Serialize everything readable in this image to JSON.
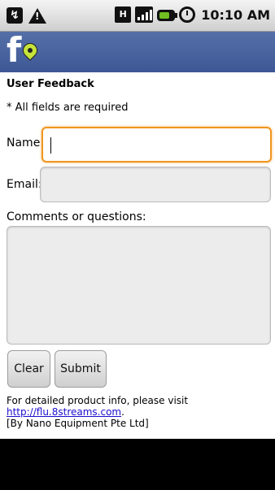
{
  "status_bar": {
    "time": "10:10 AM"
  },
  "app": {
    "logo_text": "f"
  },
  "form": {
    "title": "User Feedback",
    "required_note": "* All fields are required",
    "name_label": "Name:",
    "name_value": "",
    "email_label": "Email:",
    "email_value": "",
    "comments_label": "Comments or questions:",
    "comments_value": "",
    "clear_label": "Clear",
    "submit_label": "Submit"
  },
  "footer": {
    "info_text": "For detailed product info, please visit",
    "link_text": "http://flu.8streams.com",
    "link_suffix": ".",
    "company": "[By Nano Equipment Pte Ltd]"
  },
  "colors": {
    "header_bg": "#4a64a0",
    "focus_border": "#f0961e",
    "link": "#1a0dcc",
    "logo_pin": "#c6e33a"
  }
}
